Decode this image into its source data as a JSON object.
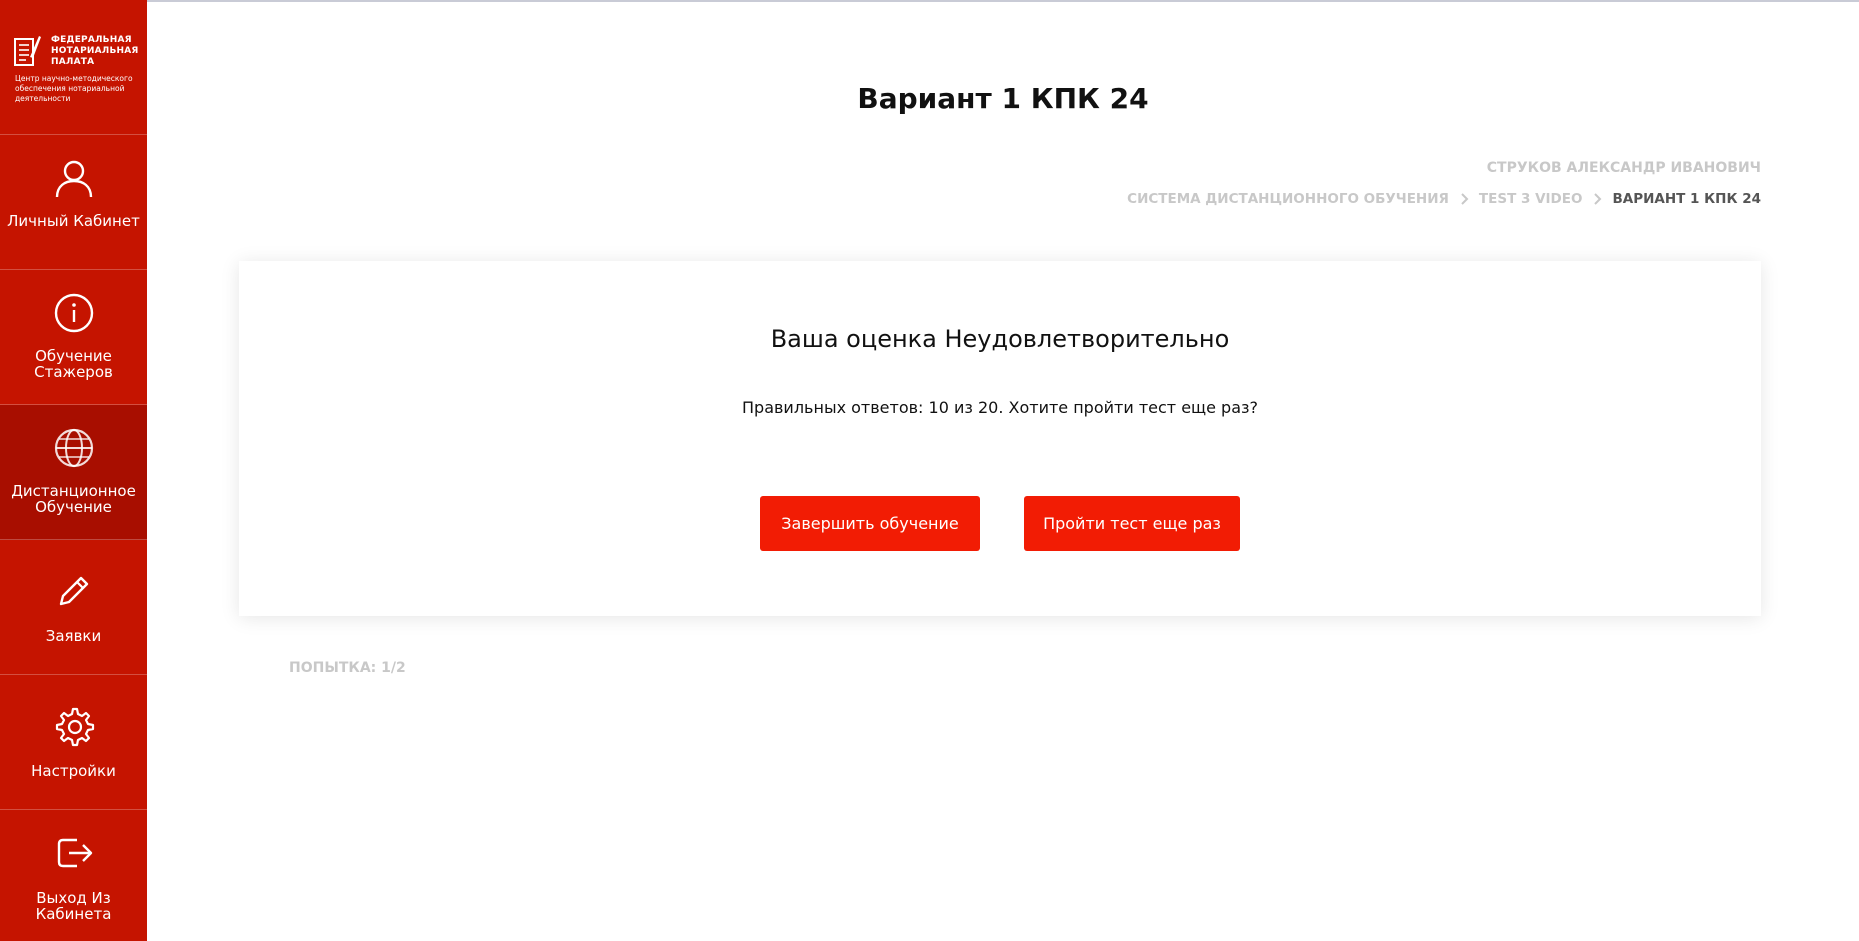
{
  "sidebar": {
    "logo": {
      "org": "ФЕДЕРАЛЬНАЯ НОТАРИАЛЬНАЯ ПАЛАТА",
      "subtitle": "Центр научно-методического обеспечения нотариальной деятельности"
    },
    "items": [
      {
        "label": "Личный Кабинет",
        "icon": "user-icon"
      },
      {
        "label": "Обучение Стажеров",
        "icon": "info-icon"
      },
      {
        "label": "Дистанционное Обучение",
        "icon": "globe-icon",
        "active": true
      },
      {
        "label": "Заявки",
        "icon": "pencil-icon"
      },
      {
        "label": "Настройки",
        "icon": "gear-icon"
      },
      {
        "label": "Выход Из Кабинета",
        "icon": "logout-icon"
      }
    ]
  },
  "header": {
    "title": "Вариант 1 КПК 24",
    "user_name": "СТРУКОВ АЛЕКСАНДР ИВАНОВИЧ",
    "breadcrumb": [
      "СИСТЕМА ДИСТАНЦИОННОГО ОБУЧЕНИЯ",
      "TEST 3 VIDEO",
      "ВАРИАНТ 1 КПК 24"
    ]
  },
  "result": {
    "title": "Ваша оценка Неудовлетворительно",
    "text": "Правильных ответов: 10 из 20. Хотите пройти тест еще раз?",
    "finish_button": "Завершить обучение",
    "retry_button": "Пройти тест еще раз"
  },
  "attempt": "ПОПЫТКА: 1/2",
  "colors": {
    "sidebar": "#c51400",
    "sidebar_active": "#a80e00",
    "button": "#f21c04",
    "muted_text": "#c8c8c8"
  }
}
